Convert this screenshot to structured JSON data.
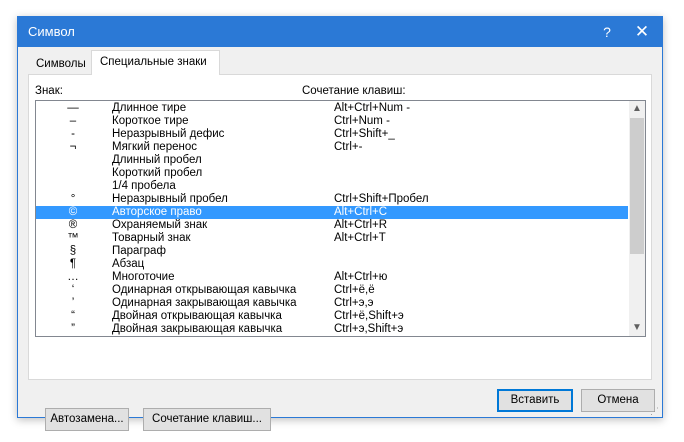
{
  "window": {
    "title": "Символ",
    "help_label": "?",
    "close_label": "✕"
  },
  "tabs": [
    {
      "label": "Символы",
      "active": false
    },
    {
      "label": "Специальные знаки",
      "active": true
    }
  ],
  "panel": {
    "sign_header": "Знак:",
    "shortcut_header": "Сочетание клавиш:"
  },
  "rows": [
    {
      "symbol": "—",
      "name": "Длинное тире",
      "shortcut": "Alt+Ctrl+Num -"
    },
    {
      "symbol": "–",
      "name": "Короткое тире",
      "shortcut": "Ctrl+Num -"
    },
    {
      "symbol": "-",
      "name": "Неразрывный дефис",
      "shortcut": "Ctrl+Shift+_"
    },
    {
      "symbol": "¬",
      "name": "Мягкий перенос",
      "shortcut": "Ctrl+-"
    },
    {
      "symbol": "",
      "name": "Длинный пробел",
      "shortcut": ""
    },
    {
      "symbol": "",
      "name": "Короткий пробел",
      "shortcut": ""
    },
    {
      "symbol": "",
      "name": "1/4 пробела",
      "shortcut": ""
    },
    {
      "symbol": "°",
      "name": "Неразрывный пробел",
      "shortcut": "Ctrl+Shift+Пробел"
    },
    {
      "symbol": "©",
      "name": "Авторское право",
      "shortcut": "Alt+Ctrl+C",
      "selected": true
    },
    {
      "symbol": "®",
      "name": "Охраняемый знак",
      "shortcut": "Alt+Ctrl+R"
    },
    {
      "symbol": "™",
      "name": "Товарный знак",
      "shortcut": "Alt+Ctrl+T"
    },
    {
      "symbol": "§",
      "name": "Параграф",
      "shortcut": ""
    },
    {
      "symbol": "¶",
      "name": "Абзац",
      "shortcut": ""
    },
    {
      "symbol": "…",
      "name": "Многоточие",
      "shortcut": "Alt+Ctrl+ю"
    },
    {
      "symbol": "‘",
      "name": "Одинарная открывающая кавычка",
      "shortcut": "Ctrl+ё,ё"
    },
    {
      "symbol": "’",
      "name": "Одинарная закрывающая кавычка",
      "shortcut": "Ctrl+э,э"
    },
    {
      "symbol": "“",
      "name": "Двойная открывающая кавычка",
      "shortcut": "Ctrl+ё,Shift+э"
    },
    {
      "symbol": "”",
      "name": "Двойная закрывающая кавычка",
      "shortcut": "Ctrl+э,Shift+э"
    }
  ],
  "scrollbar": {
    "up_icon": "▲",
    "down_icon": "▼"
  },
  "buttons": {
    "autocorrect": "Автозамена...",
    "shortcut_key": "Сочетание клавиш...",
    "insert": "Вставить",
    "cancel": "Отмена"
  },
  "resize_grip": "⋰"
}
